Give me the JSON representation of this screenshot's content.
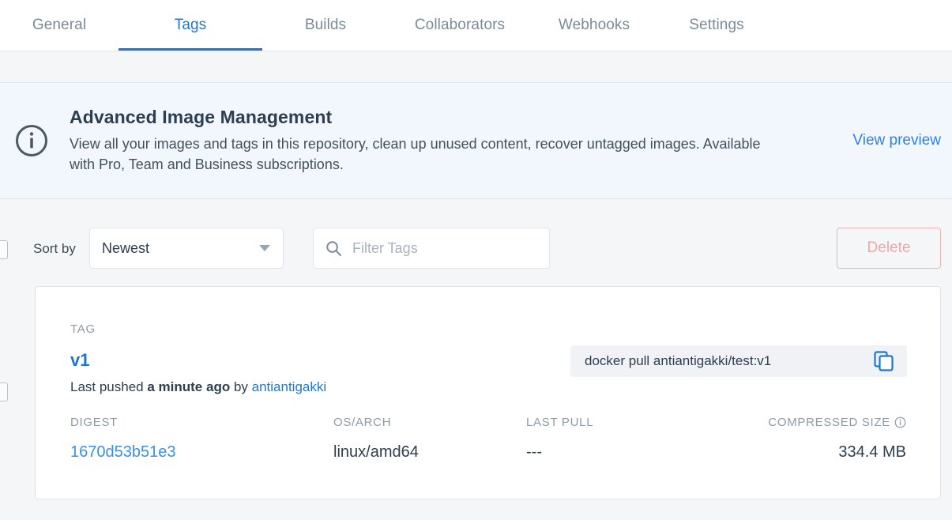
{
  "tabs": [
    {
      "label": "General",
      "active": false
    },
    {
      "label": "Tags",
      "active": true
    },
    {
      "label": "Builds",
      "active": false
    },
    {
      "label": "Collaborators",
      "active": false
    },
    {
      "label": "Webhooks",
      "active": false
    },
    {
      "label": "Settings",
      "active": false
    }
  ],
  "banner": {
    "icon": "info-circle-icon",
    "title": "Advanced Image Management",
    "body": "View all your images and tags in this repository, clean up unused content, recover untagged images. Available with Pro, Team and Business subscriptions.",
    "link_label": "View preview",
    "background_color": "#F2F7FD",
    "link_color": "#2F80ED"
  },
  "toolbar": {
    "sort_label": "Sort by",
    "sort_value": "Newest",
    "sort_options": [
      "Newest"
    ],
    "filter_placeholder": "Filter Tags",
    "filter_value": "",
    "search_icon": "search-icon",
    "delete_label": "Delete",
    "delete_color": "#EDA8A4"
  },
  "tag_card": {
    "tag_column_label": "TAG",
    "tag_name": "v1",
    "pushed_prefix": "Last pushed ",
    "pushed_time": "a minute ago",
    "pushed_by": " by ",
    "pushed_user": "antiantigakki",
    "pull_command": "docker pull antiantigakki/test:v1",
    "copy_icon": "copy-icon",
    "details": [
      {
        "label": "DIGEST",
        "value": "1670d53b51e3",
        "is_link": true
      },
      {
        "label": "OS/ARCH",
        "value": "linux/amd64",
        "is_link": false
      },
      {
        "label": "LAST PULL",
        "value": "---",
        "is_link": false
      },
      {
        "label": "COMPRESSED SIZE",
        "value": "334.4 MB",
        "is_link": false,
        "info_icon": "info-icon"
      }
    ]
  },
  "colors": {
    "accent_blue": "#1D77D2",
    "page_background": "#F5F6F8",
    "card_background": "#FFFFFF"
  }
}
